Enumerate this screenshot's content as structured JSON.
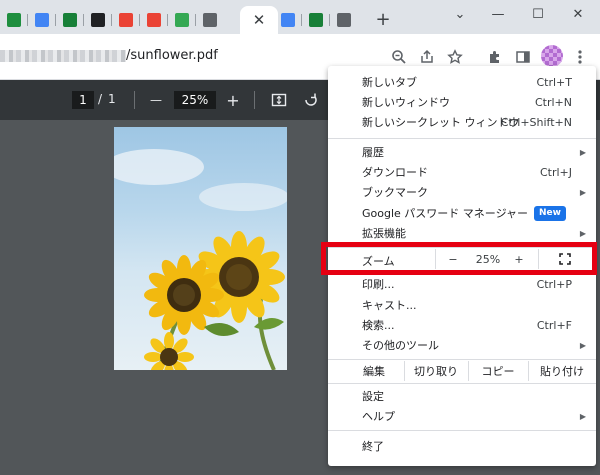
{
  "window_controls": {
    "collapse": "⌄",
    "minimize": "—",
    "maximize": "☐",
    "close": "✕"
  },
  "tabs": [
    {
      "favicon_color": "#1e8e3e"
    },
    {
      "favicon_color": "#4285f4"
    },
    {
      "favicon_color": "#188038"
    },
    {
      "favicon_color": "#202124"
    },
    {
      "favicon_color": "#ea4335"
    },
    {
      "favicon_color": "#ea4335"
    },
    {
      "favicon_color": "#34a853"
    },
    {
      "favicon_color": "#5f6368"
    }
  ],
  "active_tab": {
    "close": "✕"
  },
  "extra_tabs": [
    {
      "favicon_color": "#4285f4"
    },
    {
      "favicon_color": "#188038"
    },
    {
      "favicon_color": "#5f6368"
    }
  ],
  "new_tab_label": "+",
  "address": {
    "url_suffix": "/sunflower.pdf"
  },
  "pdf_toolbar": {
    "current_page": "1",
    "page_sep": "/",
    "total_pages": "1",
    "zoom_out": "—",
    "zoom_value": "25%",
    "zoom_in": "+"
  },
  "menu": {
    "group1": [
      {
        "label": "新しいタブ",
        "shortcut": "Ctrl+T"
      },
      {
        "label": "新しいウィンドウ",
        "shortcut": "Ctrl+N"
      },
      {
        "label": "新しいシークレット ウィンドウ",
        "shortcut": "Ctrl+Shift+N"
      }
    ],
    "group2": [
      {
        "label": "履歴",
        "shortcut": "",
        "submenu": true
      },
      {
        "label": "ダウンロード",
        "shortcut": "Ctrl+J"
      },
      {
        "label": "ブックマーク",
        "shortcut": "",
        "submenu": true
      },
      {
        "label": "Google パスワード マネージャー",
        "badge": "New"
      },
      {
        "label": "拡張機能",
        "shortcut": "",
        "submenu": true
      }
    ],
    "zoom": {
      "label": "ズーム",
      "minus": "−",
      "value": "25%",
      "plus": "+"
    },
    "group3": [
      {
        "label": "印刷...",
        "shortcut": "Ctrl+P"
      },
      {
        "label": "キャスト..."
      },
      {
        "label": "検索...",
        "shortcut": "Ctrl+F"
      },
      {
        "label": "その他のツール",
        "submenu": true
      }
    ],
    "edit": {
      "label": "編集",
      "cut": "切り取り",
      "copy": "コピー",
      "paste": "貼り付け"
    },
    "group4": [
      {
        "label": "設定"
      },
      {
        "label": "ヘルプ",
        "submenu": true
      }
    ],
    "exit": "終了",
    "submenu_arrow": "▶"
  },
  "highlight_color": "#e60012"
}
